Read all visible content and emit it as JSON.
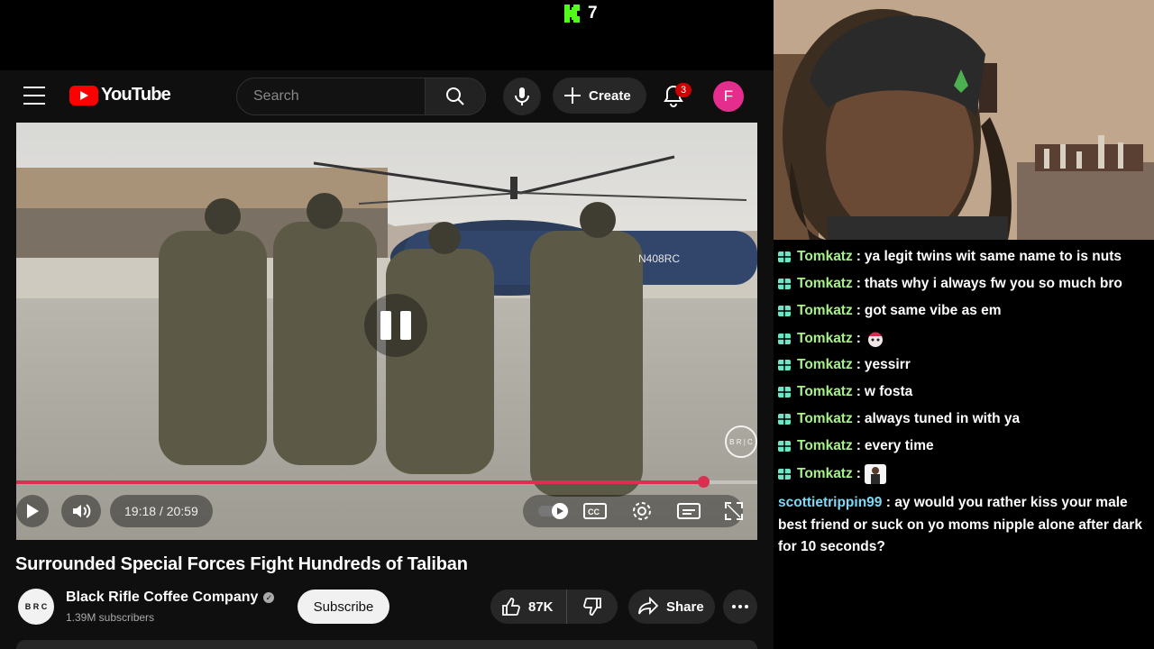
{
  "kick": {
    "viewer_count": "7",
    "accent": "#53fc18"
  },
  "youtube": {
    "logo_text": "YouTube",
    "search": {
      "placeholder": "Search"
    },
    "create_label": "Create",
    "notifications_count": "3",
    "avatar_letter": "F",
    "video": {
      "tail_number": "N408RC",
      "watermark": "B R | C",
      "current_time": "19:18 / 20:59",
      "progress_fraction": 0.927,
      "progress_color": "#d9304f"
    },
    "title": "Surrounded Special Forces Fight Hundreds of Taliban",
    "channel": {
      "name": "Black Rifle Coffee Company",
      "subscribers": "1.39M subscribers",
      "avatar_text": "B R C"
    },
    "subscribe_label": "Subscribe",
    "likes": "87K",
    "share_label": "Share"
  },
  "chat": {
    "user_color": "#a8f08a",
    "messages": [
      {
        "user": "Tomkatz",
        "text": "ya legit twins wit same name to is nuts"
      },
      {
        "user": "Tomkatz",
        "text": "thats why i always fw you so much bro"
      },
      {
        "user": "Tomkatz",
        "text": "got same vibe as em"
      },
      {
        "user": "Tomkatz",
        "text": ""
      },
      {
        "user": "Tomkatz",
        "text": "yessirr"
      },
      {
        "user": "Tomkatz",
        "text": "w fosta"
      },
      {
        "user": "Tomkatz",
        "text": "always tuned in with ya"
      },
      {
        "user": "Tomkatz",
        "text": "every time"
      },
      {
        "user": "Tomkatz",
        "text": ""
      }
    ],
    "last_message": {
      "user": "scottietrippin99",
      "text": "ay would you rather kiss your male best friend or suck on yo moms nipple alone after dark for 10 seconds?"
    }
  }
}
